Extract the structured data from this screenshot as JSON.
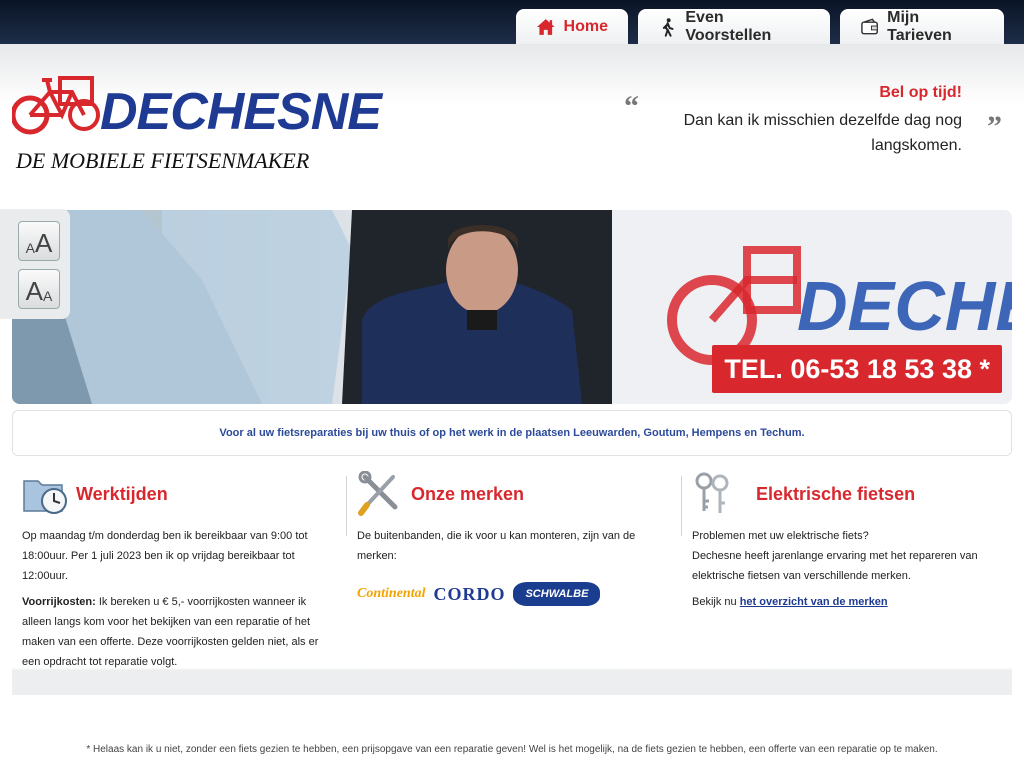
{
  "nav": {
    "tabs": [
      {
        "label": "Home",
        "icon": "home-icon",
        "active": true
      },
      {
        "label": "Even Voorstellen",
        "icon": "walking-person-icon",
        "active": false
      },
      {
        "label": "Mijn Tarieven",
        "icon": "wallet-icon",
        "active": false
      }
    ]
  },
  "logo": {
    "word": "DECHESNE",
    "subtitle": "DE MOBIELE FIETSENMAKER"
  },
  "quote": {
    "title": "Bel op tijd!",
    "text": "Dan kan ik misschien dezelfde dag nog langskomen.",
    "open": "“",
    "close": "”"
  },
  "font_controls": {
    "decrease_small": "A",
    "decrease_big": "A",
    "increase_big": "A",
    "increase_small": "A"
  },
  "hero": {
    "phone": "TEL. 06-53 18 53 38 *",
    "van_logo_text": "DECHESNE"
  },
  "strip": {
    "text": "Voor al uw fietsreparaties bij uw thuis of op het werk in de plaatsen Leeuwarden, Goutum, Hempens en Techum."
  },
  "columns": [
    {
      "title": "Werktijden",
      "icon": "folder-clock-icon",
      "p1": "Op maandag t/m donderdag ben ik bereikbaar van 9:00 tot 18:00uur. Per 1 juli 2023 ben ik op vrijdag bereikbaar tot 12:00uur.",
      "p2_label": "Voorrijkosten:",
      "p2": "Ik bereken u € 5,- voorrijkosten wanneer ik alleen langs kom voor het bekijken van een reparatie of het maken van een offerte. Deze voorrijkosten gelden niet, als er een opdracht tot reparatie volgt."
    },
    {
      "title": "Onze merken",
      "icon": "tools-icon",
      "p1": "De buitenbanden, die ik voor u kan monteren, zijn van de merken:",
      "brands": [
        "Continental",
        "CORDO",
        "SCHWALBE"
      ]
    },
    {
      "title": "Elektrische fietsen",
      "icon": "keys-icon",
      "p1": "Problemen met uw elektrische fiets?",
      "p2": "Dechesne heeft jarenlange ervaring met het repareren van elektrische fietsen van verschillende merken.",
      "p3_pre": "Bekijk nu",
      "p3_link": "het overzicht van de merken"
    }
  ],
  "footnote": "* Helaas kan ik u niet, zonder een fiets gezien te hebben, een prijsopgave van een reparatie geven! Wel is het mogelijk, na de fiets gezien te hebben, een offerte van een reparatie op te maken.",
  "colors": {
    "accent_red": "#d8282e",
    "brand_blue": "#1f3a93",
    "topbar": "#0a1426"
  }
}
